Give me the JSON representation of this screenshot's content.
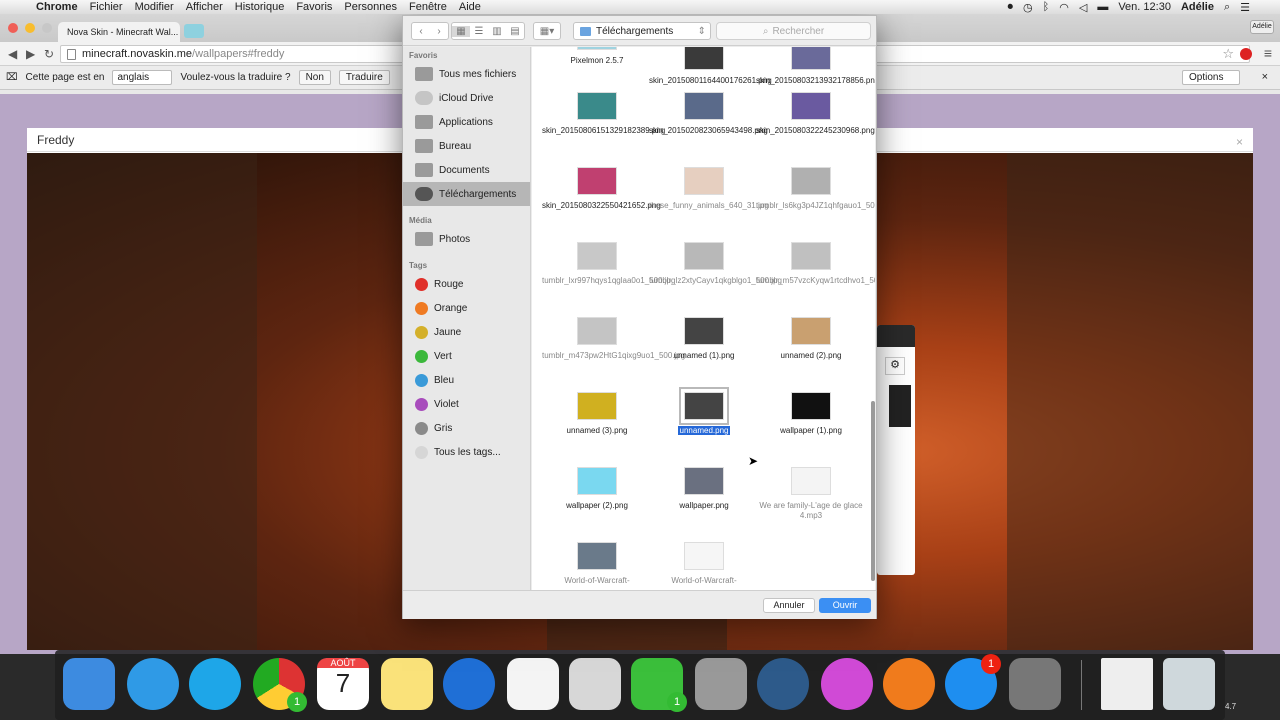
{
  "menubar": {
    "app": "Chrome",
    "items": [
      "Fichier",
      "Modifier",
      "Afficher",
      "Historique",
      "Favoris",
      "Personnes",
      "Fenêtre",
      "Aide"
    ],
    "clock": "Ven. 12:30",
    "user": "Adélie"
  },
  "browser": {
    "tab_title": "Nova Skin - Minecraft Wal...",
    "url_host": "minecraft.novaskin.me",
    "url_path": "/wallpapers#freddy",
    "profile": "Adélie"
  },
  "translate": {
    "prompt": "Cette page est en",
    "language": "anglais",
    "question": "Voulez-vous la traduire ?",
    "no": "Non",
    "yes": "Traduire",
    "options": "Options"
  },
  "modal": {
    "title": "Freddy"
  },
  "dialog": {
    "path": "Téléchargements",
    "search_placeholder": "Rechercher",
    "favorites_header": "Favoris",
    "favorites": [
      "Tous mes fichiers",
      "iCloud Drive",
      "Applications",
      "Bureau",
      "Documents",
      "Téléchargements"
    ],
    "media_header": "Média",
    "media": [
      "Photos"
    ],
    "tags_header": "Tags",
    "tags": [
      {
        "label": "Rouge",
        "color": "#e0302a"
      },
      {
        "label": "Orange",
        "color": "#ef7a22"
      },
      {
        "label": "Jaune",
        "color": "#d4b02a"
      },
      {
        "label": "Vert",
        "color": "#3cb83c"
      },
      {
        "label": "Bleu",
        "color": "#3a9ad8"
      },
      {
        "label": "Violet",
        "color": "#a84cbc"
      },
      {
        "label": "Gris",
        "color": "#8a8a8a"
      },
      {
        "label": "Tous les tags...",
        "color": "#d6d6d6"
      }
    ],
    "files": [
      {
        "name": "Pixelmon 2.5.7",
        "dim": false
      },
      {
        "name": "skin_20150801164400176261.png",
        "dim": false
      },
      {
        "name": "skin_20150803213932178856.png",
        "dim": false
      },
      {
        "name": "skin_20150806151329182389.png",
        "dim": false
      },
      {
        "name": "skin_2015020823065943498.png",
        "dim": false
      },
      {
        "name": "skin_2015080322245230968.png",
        "dim": false
      },
      {
        "name": "skin_2015080322550421652.png",
        "dim": false
      },
      {
        "name": "these_funny_animals_640_31.jpg",
        "dim": true
      },
      {
        "name": "tumblr_ls6kg3p4JZ1qhfgauo1_500.jpg",
        "dim": true
      },
      {
        "name": "tumblr_lxr997hqys1qglaa0o1_500.jpg",
        "dim": true
      },
      {
        "name": "tumblr_lz2xtyCayv1qkgblgo1_500.jpg",
        "dim": true
      },
      {
        "name": "tumblr_m57vzcKyqw1rtcdhvo1_500.jpg",
        "dim": true
      },
      {
        "name": "tumblr_m473pw2HtG1qixg9uo1_500.jpg",
        "dim": true
      },
      {
        "name": "unnamed (1).png",
        "dim": false
      },
      {
        "name": "unnamed (2).png",
        "dim": false
      },
      {
        "name": "unnamed (3).png",
        "dim": false
      },
      {
        "name": "unnamed.png",
        "dim": false,
        "selected": true
      },
      {
        "name": "wallpaper (1).png",
        "dim": false
      },
      {
        "name": "wallpaper (2).png",
        "dim": false
      },
      {
        "name": "wallpaper.png",
        "dim": false
      },
      {
        "name": "We are family-L'age de glace 4.mp3",
        "dim": true
      },
      {
        "name": "World-of-Warcraft-",
        "dim": true
      },
      {
        "name": "World-of-Warcraft-",
        "dim": true
      }
    ],
    "cancel": "Annuler",
    "open": "Ouvrir"
  },
  "dock": {
    "calendar_month": "AOÛT",
    "calendar_day": "7",
    "appstore_badge": "1",
    "facetime_badge": "1",
    "version": "4.7"
  }
}
